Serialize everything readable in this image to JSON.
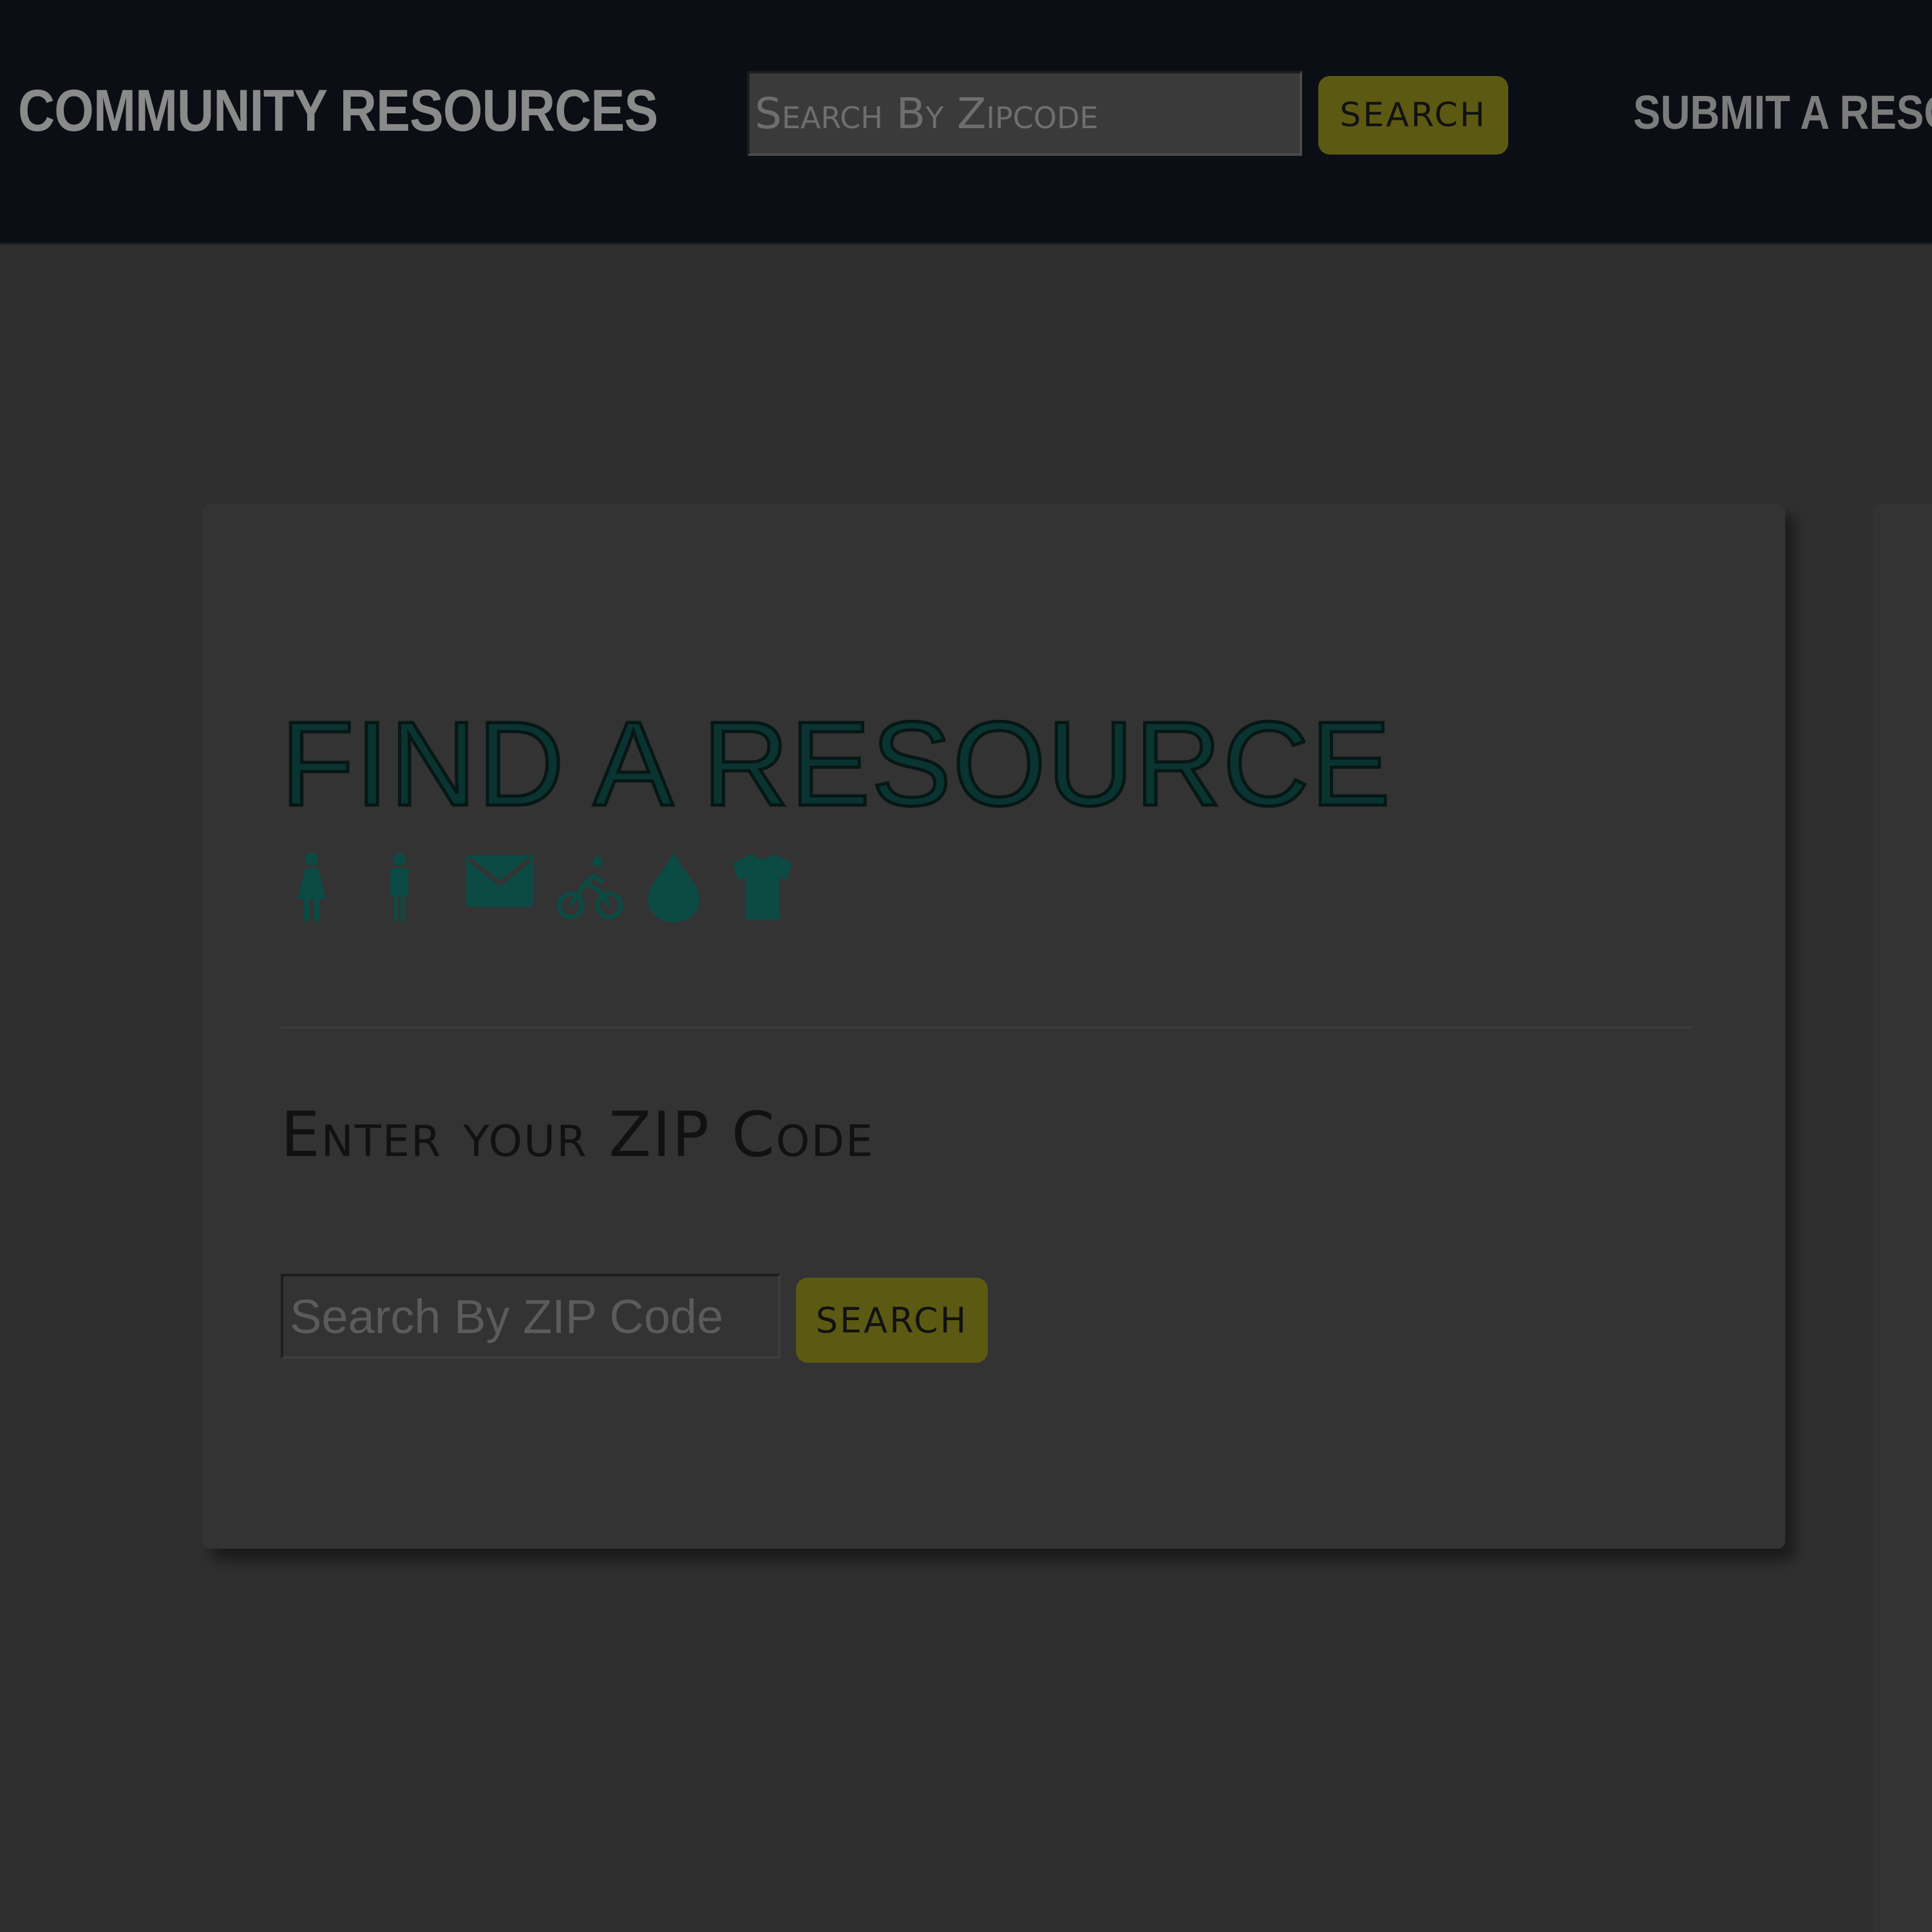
{
  "header": {
    "brand": "COMMUNITY RESOURCES",
    "search_placeholder": "Search By Zipcode",
    "search_button": "SEARCH",
    "submit_link": "SUBMIT A RESO"
  },
  "card": {
    "title": "FIND A RESOURCE",
    "icons": [
      "female-restroom-icon",
      "male-restroom-icon",
      "mail-icon",
      "bicycle-icon",
      "water-drop-icon",
      "t-shirt-icon"
    ],
    "zip_label": "Enter your ZIP Code",
    "zip_placeholder": "Search By ZIP Code",
    "zip_button": "SEARCH"
  },
  "colors": {
    "nav_background": "#0b0e14",
    "page_background": "#2f2f2f",
    "accent_button": "#5c5a12",
    "title_color": "#0a3431",
    "icon_color": "#0c4a44"
  }
}
